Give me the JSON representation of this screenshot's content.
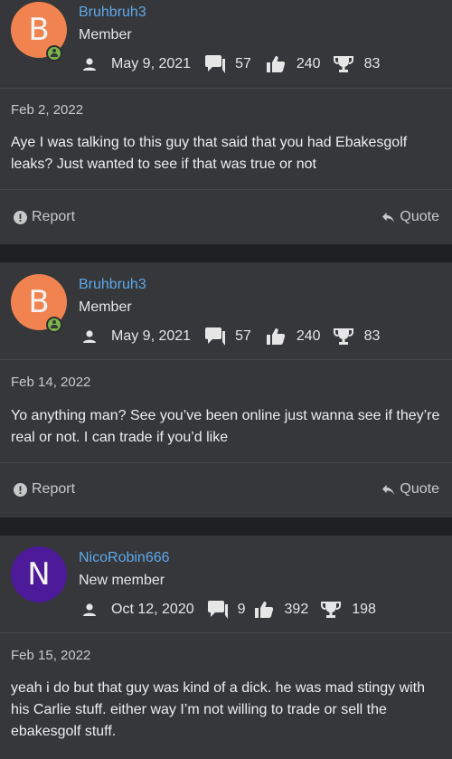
{
  "posts": [
    {
      "avatar_letter": "B",
      "avatar_color": "#f0834f",
      "username": "Bruhbruh3",
      "user_title": "Member",
      "joined": "May 9, 2021",
      "messages": "57",
      "reactions": "240",
      "points": "83",
      "date": "Feb 2, 2022",
      "text": "Aye I was talking to this guy that said that you had Ebakesgolf leaks? Just wanted to see if that was true or not",
      "report_label": "Report",
      "quote_label": "Quote"
    },
    {
      "avatar_letter": "B",
      "avatar_color": "#f0834f",
      "username": "Bruhbruh3",
      "user_title": "Member",
      "joined": "May 9, 2021",
      "messages": "57",
      "reactions": "240",
      "points": "83",
      "date": "Feb 14, 2022",
      "text": "Yo anything man? See you’ve been online just wanna see if they’re real or not. I can trade if you’d like",
      "report_label": "Report",
      "quote_label": "Quote"
    },
    {
      "avatar_letter": "N",
      "avatar_color": "#4d1a99",
      "username": "NicoRobin666",
      "user_title": "New member",
      "joined": "Oct 12, 2020",
      "messages": "9",
      "reactions": "392",
      "points": "198",
      "date": "Feb 15, 2022",
      "text": "yeah i do but that guy was kind of a dick. he was mad stingy with his Carlie stuff. either way I’m not willing to trade or sell the ebakesgolf stuff."
    }
  ],
  "colors": {
    "page_background": "#1e1f21",
    "post_background": "#35373b",
    "username": "#5fa8e8",
    "online_badge": "#7ab547"
  },
  "icons": {
    "joined": "user-icon",
    "messages": "comments-icon",
    "reactions": "thumbs-up-icon",
    "points": "trophy-icon",
    "report": "exclamation-circle-icon",
    "quote": "reply-arrow-icon"
  }
}
